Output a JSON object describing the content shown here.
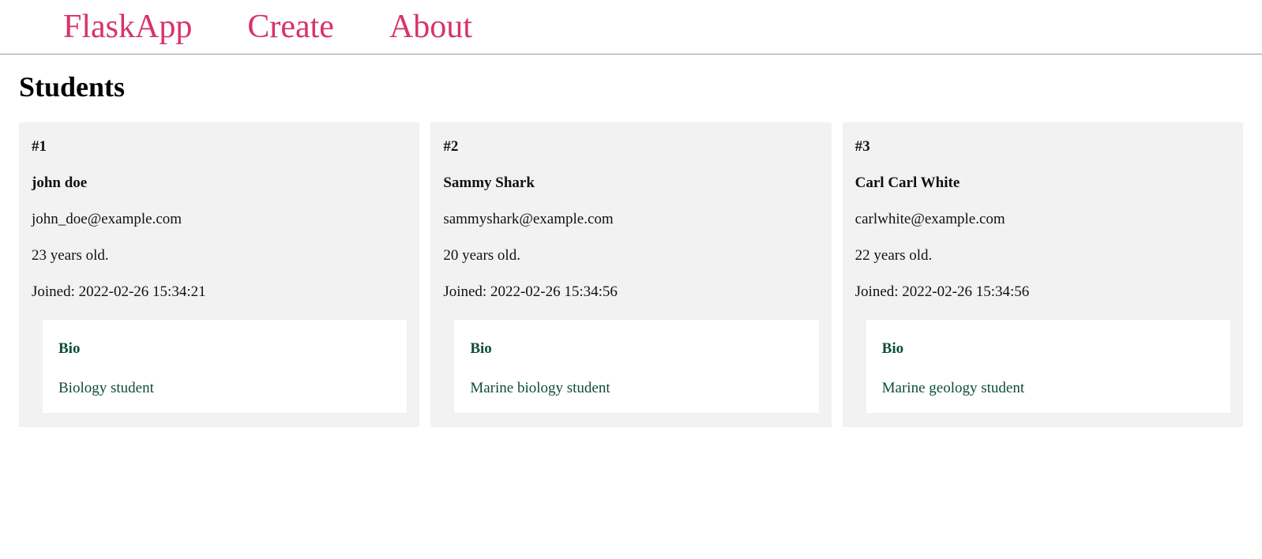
{
  "nav": {
    "brand": "FlaskApp",
    "create": "Create",
    "about": "About"
  },
  "page_title": "Students",
  "joined_prefix": "Joined: ",
  "age_suffix": " years old.",
  "bio_label": "Bio",
  "students": [
    {
      "id_label": "#1",
      "name": "john doe",
      "email": "john_doe@example.com",
      "age_text": "23 years old.",
      "joined_text": "Joined: 2022-02-26 15:34:21",
      "bio": "Biology student"
    },
    {
      "id_label": "#2",
      "name": "Sammy Shark",
      "email": "sammyshark@example.com",
      "age_text": "20 years old.",
      "joined_text": "Joined: 2022-02-26 15:34:56",
      "bio": "Marine biology student"
    },
    {
      "id_label": "#3",
      "name": "Carl Carl White",
      "email": "carlwhite@example.com",
      "age_text": "22 years old.",
      "joined_text": "Joined: 2022-02-26 15:34:56",
      "bio": "Marine geology student"
    }
  ]
}
